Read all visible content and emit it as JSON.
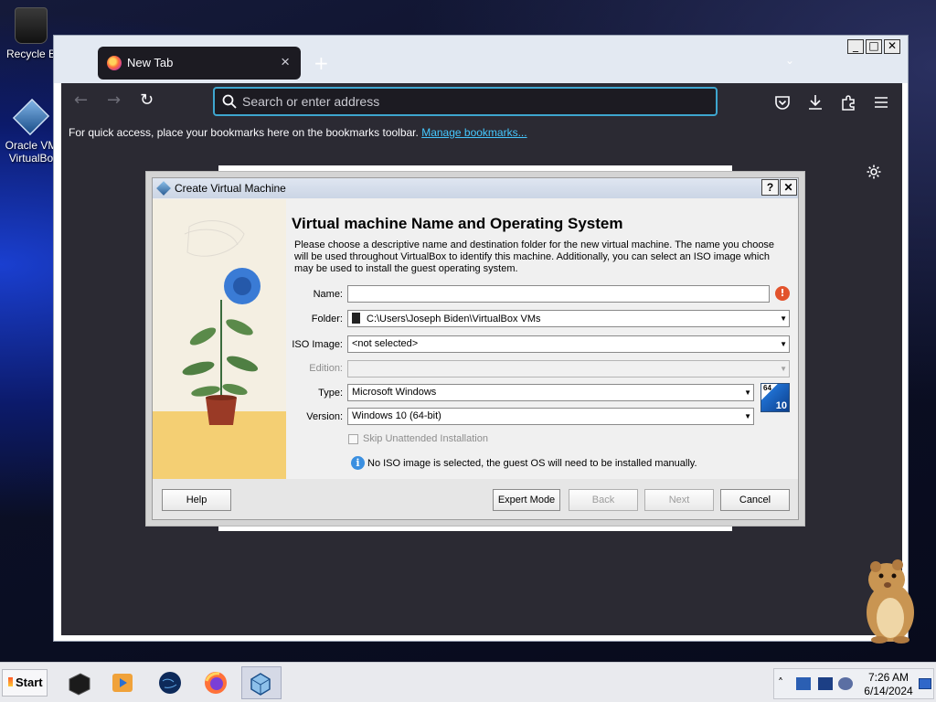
{
  "desktop": {
    "icons": [
      {
        "label": "Recycle B"
      },
      {
        "label": "Oracle VM VirtualBo"
      }
    ]
  },
  "browser": {
    "tab_title": "New Tab",
    "tab_close": "×",
    "new_tab": "+",
    "tab_list": "⌄",
    "window_controls": {
      "minimize": "_",
      "maximize": "□",
      "close": "✕"
    },
    "nav": {
      "back": "←",
      "forward": "→",
      "reload": "↻"
    },
    "url_bar": {
      "placeholder": "Search or enter address",
      "value": ""
    },
    "toolbar_icons": [
      "pocket-icon",
      "download-icon",
      "extensions-icon",
      "menu-icon"
    ],
    "bookmarks_bar": {
      "text": "For quick access, place your bookmarks here on the bookmarks toolbar.",
      "link": "Manage bookmarks..."
    }
  },
  "dialog": {
    "title": "Create Virtual Machine",
    "help_symbol": "?",
    "close_symbol": "✕",
    "heading": "Virtual machine Name and Operating System",
    "description": "Please choose a descriptive name and destination folder for the new virtual machine. The name you choose will be used throughout VirtualBox to identify this machine. Additionally, you can select an ISO image which may be used to install the guest operating system.",
    "fields": {
      "name": {
        "label": "Name:",
        "value": ""
      },
      "folder": {
        "label": "Folder:",
        "value": "C:\\Users\\Joseph Biden\\VirtualBox VMs"
      },
      "iso": {
        "label": "ISO Image:",
        "value": "<not selected>"
      },
      "edition": {
        "label": "Edition:",
        "value": ""
      },
      "type": {
        "label": "Type:",
        "value": "Microsoft Windows"
      },
      "version": {
        "label": "Version:",
        "value": "Windows 10 (64-bit)"
      }
    },
    "os_badge": {
      "bits": "64",
      "version": "10"
    },
    "skip_unattended": {
      "label": "Skip Unattended Installation",
      "checked": false
    },
    "info_message": "No ISO image is selected, the guest OS will need to be installed manually.",
    "buttons": {
      "help": "Help",
      "expert": "Expert Mode",
      "back": "Back",
      "next": "Next",
      "cancel": "Cancel"
    }
  },
  "taskbar": {
    "start": "Start",
    "tray_arrow": "˄",
    "clock": {
      "time": "7:26 AM",
      "date": "6/14/2024"
    }
  },
  "colors": {
    "browser_chrome": "#2b2a33",
    "url_focus": "#3ea6cf",
    "link": "#45c8ff",
    "dialog_bg": "#f0f0f0",
    "warning": "#e2532c",
    "info": "#3a8fe0"
  }
}
